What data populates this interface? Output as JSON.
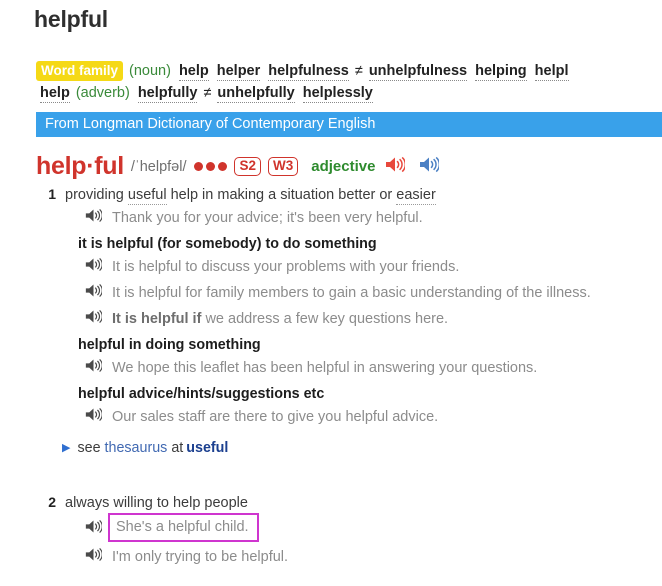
{
  "page": {
    "title": "helpful"
  },
  "colors": {
    "headword_red": "#d0342c",
    "banner_blue": "#39a1ea",
    "wordfamily_yellow": "#f5d916",
    "pos_green": "#2e8b2e",
    "highlight_magenta": "#cf35cf",
    "thesaurus_link_blue": "#4169b2"
  },
  "word_family": {
    "badge": "Word family",
    "line1": [
      {
        "type": "pos",
        "text": "(noun)"
      },
      {
        "type": "word",
        "text": "help"
      },
      {
        "type": "word",
        "text": "helper"
      },
      {
        "type": "word",
        "text": "helpfulness"
      },
      {
        "type": "neq",
        "text": "≠"
      },
      {
        "type": "word",
        "text": "unhelpfulness"
      },
      {
        "type": "word",
        "text": "helping"
      },
      {
        "type": "word",
        "text": "helpl"
      }
    ],
    "line2": [
      {
        "type": "word",
        "text": "help"
      },
      {
        "type": "pos",
        "text": "(adverb)"
      },
      {
        "type": "word",
        "text": "helpfully"
      },
      {
        "type": "neq",
        "text": "≠"
      },
      {
        "type": "word",
        "text": "unhelpfully"
      },
      {
        "type": "word",
        "text": "helplessly"
      }
    ]
  },
  "source_banner": {
    "text": "From Longman Dictionary of Contemporary English"
  },
  "entry": {
    "headword": "help·ful",
    "pronunciation": "/ˈhelpfəl/",
    "frequency_dots": 3,
    "level_badges": [
      "S2",
      "W3"
    ],
    "part_of_speech": "adjective",
    "audio_br_label": "british-pronunciation-speaker",
    "audio_am_label": "american-pronunciation-speaker"
  },
  "senses": [
    {
      "number": "1",
      "definition_parts": [
        {
          "text": "providing ",
          "style": "plain"
        },
        {
          "text": "useful",
          "style": "dotted"
        },
        {
          "text": " help in making a situation better or ",
          "style": "plain"
        },
        {
          "text": "easier",
          "style": "dotted"
        }
      ],
      "definition_plain": "providing useful help in making a situation better or easier",
      "blocks": [
        {
          "kind": "example",
          "text": "Thank you for your advice; it's been very helpful."
        },
        {
          "kind": "collocation",
          "text": "it is helpful (for somebody) to do something"
        },
        {
          "kind": "example",
          "text": "It is helpful to discuss your problems with your friends."
        },
        {
          "kind": "example",
          "text": "It is helpful for family members to gain a basic understanding of the illness."
        },
        {
          "kind": "example",
          "bold_prefix": "It is helpful if",
          "text": " we address a few key questions here."
        },
        {
          "kind": "collocation",
          "text": "helpful in doing something"
        },
        {
          "kind": "example",
          "text": "We hope this leaflet has been helpful in answering your questions."
        },
        {
          "kind": "collocation",
          "text": "helpful advice/hints/suggestions etc"
        },
        {
          "kind": "example",
          "text": "Our sales staff are there to give you helpful advice."
        }
      ],
      "thesaurus": {
        "see": "see",
        "link": "thesaurus",
        "at": "at",
        "target": "useful"
      }
    },
    {
      "number": "2",
      "definition_plain": "always willing to help people",
      "blocks": [
        {
          "kind": "example",
          "text": "She's a helpful child.",
          "highlighted": true
        },
        {
          "kind": "example",
          "text": "I'm only trying to be helpful."
        }
      ]
    }
  ]
}
